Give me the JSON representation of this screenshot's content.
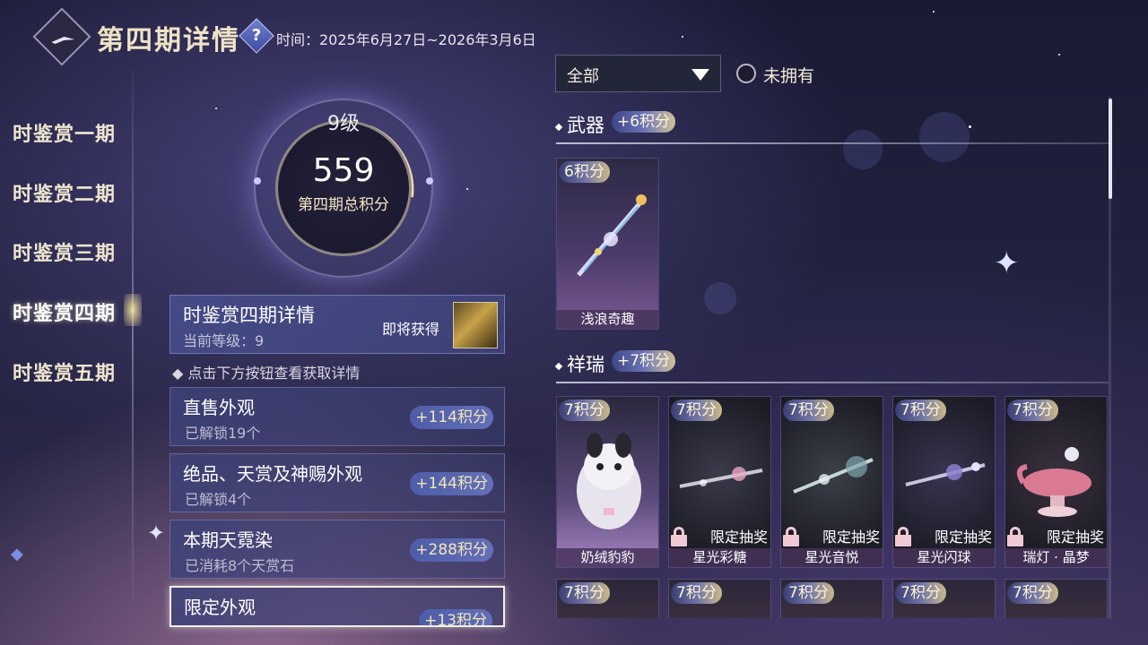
{
  "header": {
    "title": "第四期详情",
    "help_label": "?",
    "period": "时间：2025年6月27日~2026年3月6日"
  },
  "nav": {
    "items": [
      {
        "label": "时鉴赏一期",
        "active": false
      },
      {
        "label": "时鉴赏二期",
        "active": false
      },
      {
        "label": "时鉴赏三期",
        "active": false
      },
      {
        "label": "时鉴赏四期",
        "active": true
      },
      {
        "label": "时鉴赏五期",
        "active": false
      }
    ]
  },
  "summary": {
    "level": "9级",
    "score": "559",
    "score_label": "第四期总积分"
  },
  "detail": {
    "title": "时鉴赏四期详情",
    "current_level": "当前等级：9",
    "upcoming_label": "即将获得"
  },
  "hint": "◆ 点击下方按钮查看获取详情",
  "categories": [
    {
      "title": "直售外观",
      "sub": "已解锁19个",
      "points": "+114积分"
    },
    {
      "title": "绝品、天赏及神赐外观",
      "sub": "已解锁4个",
      "points": "+144积分"
    },
    {
      "title": "本期天霓染",
      "sub": "已消耗8个天赏石",
      "points": "+288积分"
    },
    {
      "title": "限定外观",
      "sub": "",
      "points": "+13积分"
    }
  ],
  "filter": {
    "selected": "全部",
    "unowned_label": "未拥有"
  },
  "sections": [
    {
      "title": "武器",
      "points": "+6积分",
      "items": [
        {
          "points": "6积分",
          "name": "浅浪奇趣",
          "tag": "",
          "locked": false
        }
      ]
    },
    {
      "title": "祥瑞",
      "points": "+7积分",
      "items": [
        {
          "points": "7积分",
          "name": "奶绒豹豹",
          "tag": "",
          "locked": false
        },
        {
          "points": "7积分",
          "name": "星光彩糖",
          "tag": "限定抽奖",
          "locked": true
        },
        {
          "points": "7积分",
          "name": "星光音悦",
          "tag": "限定抽奖",
          "locked": true
        },
        {
          "points": "7积分",
          "name": "星光闪球",
          "tag": "限定抽奖",
          "locked": true
        },
        {
          "points": "7积分",
          "name": "瑞灯 · 晶梦",
          "tag": "限定抽奖",
          "locked": true
        }
      ]
    },
    {
      "title": "",
      "points": "",
      "items": [
        {
          "points": "7积分"
        },
        {
          "points": "7积分"
        },
        {
          "points": "7积分"
        },
        {
          "points": "7积分"
        },
        {
          "points": "7积分"
        }
      ]
    }
  ],
  "colors": {
    "accent_gold": "#f5e5b6",
    "card_blue": "#3e4278",
    "lock_pink": "#f0c9d5"
  }
}
